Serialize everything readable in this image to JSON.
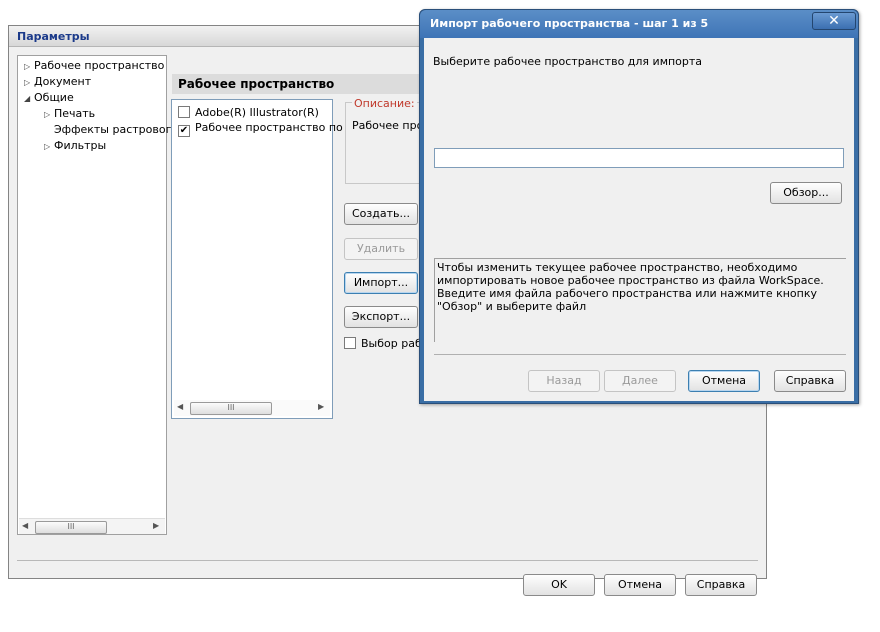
{
  "params_dialog": {
    "title": "Параметры",
    "tree": [
      {
        "label": "Рабочее пространство",
        "expander": "▷",
        "indent": 0
      },
      {
        "label": "Документ",
        "expander": "▷",
        "indent": 0
      },
      {
        "label": "Общие",
        "expander": "◢",
        "indent": 0
      },
      {
        "label": "Печать",
        "expander": "▷",
        "indent": 1
      },
      {
        "label": "Эффекты растровог",
        "expander": "",
        "indent": 1
      },
      {
        "label": "Фильтры",
        "expander": "▷",
        "indent": 1
      }
    ],
    "section_title": "Рабочее пространство",
    "workspaces": [
      {
        "label": "Adobe(R) Illustrator(R)",
        "checked": false
      },
      {
        "label": "Рабочее пространство по",
        "checked": true
      }
    ],
    "description_label": "Описание:",
    "description_text": "Рабочее прост",
    "buttons": {
      "create": "Создать...",
      "delete": "Удалить",
      "import": "Импорт...",
      "export": "Экспорт..."
    },
    "select_workspace_label": "Выбор рабоч",
    "footer": {
      "ok": "OK",
      "cancel": "Отмена",
      "help": "Справка"
    },
    "scroll_thumb": "III"
  },
  "import_dialog": {
    "title": "Импорт рабочего пространства - шаг 1 из 5",
    "close_glyph": "✕",
    "prompt": "Выберите рабочее пространство для импорта",
    "path_value": "",
    "browse": "Обзор...",
    "info": "Чтобы изменить текущее рабочее пространство, необходимо импортировать новое рабочее пространство из файла WorkSpace. Введите имя файла рабочего пространства или нажмите кнопку \"Обзор\" и выберите файл",
    "footer": {
      "back": "Назад",
      "next": "Далее",
      "cancel": "Отмена",
      "help": "Справка"
    }
  }
}
